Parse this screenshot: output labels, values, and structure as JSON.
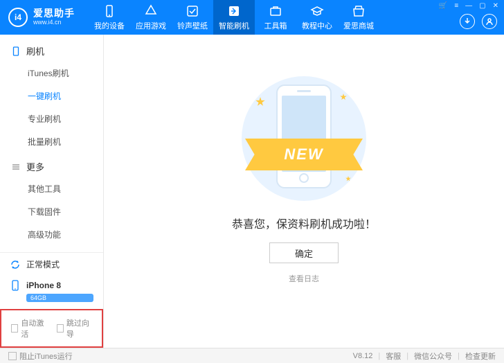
{
  "brand": {
    "name": "爱思助手",
    "url": "www.i4.cn",
    "logo_text": "i4"
  },
  "nav": [
    {
      "label": "我的设备",
      "icon": "device"
    },
    {
      "label": "应用游戏",
      "icon": "apps"
    },
    {
      "label": "铃声壁纸",
      "icon": "ring"
    },
    {
      "label": "智能刷机",
      "icon": "flash",
      "active": true
    },
    {
      "label": "工具箱",
      "icon": "tools"
    },
    {
      "label": "教程中心",
      "icon": "edu"
    },
    {
      "label": "爱思商城",
      "icon": "store"
    }
  ],
  "sidebar": {
    "sections": [
      {
        "title": "刷机",
        "items": [
          {
            "label": "iTunes刷机"
          },
          {
            "label": "一键刷机",
            "active": true
          },
          {
            "label": "专业刷机"
          },
          {
            "label": "批量刷机"
          }
        ]
      },
      {
        "title": "更多",
        "items": [
          {
            "label": "其他工具"
          },
          {
            "label": "下载固件"
          },
          {
            "label": "高级功能"
          }
        ]
      }
    ],
    "mode": "正常模式",
    "device": {
      "name": "iPhone 8",
      "storage": "64GB"
    },
    "checks": {
      "auto_activate": "自动激活",
      "skip_guide": "跳过向导"
    }
  },
  "content": {
    "ribbon": "NEW",
    "message": "恭喜您，保资料刷机成功啦！",
    "ok": "确定",
    "log": "查看日志"
  },
  "status": {
    "block_itunes": "阻止iTunes运行",
    "version": "V8.12",
    "links": [
      "客服",
      "微信公众号",
      "检查更新"
    ]
  }
}
